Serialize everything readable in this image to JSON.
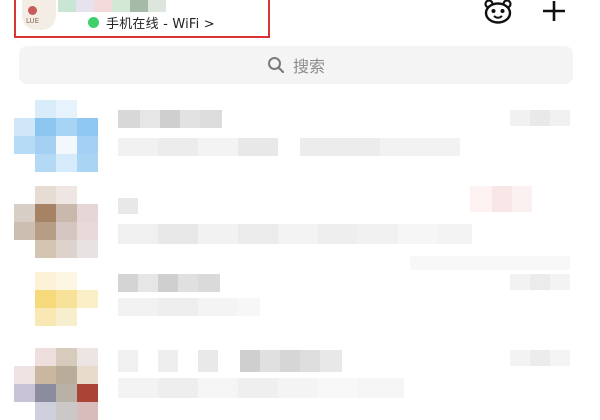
{
  "header": {
    "status_text": "手机在线 - WiFi >",
    "status_color": "#3fcf6b",
    "highlight_color": "#d93333",
    "avatar_caption": "LUE",
    "icons": [
      "mascot-icon",
      "plus-icon"
    ]
  },
  "search": {
    "placeholder": "搜索",
    "icon": "search-icon"
  },
  "conversations": [
    {
      "id": 1,
      "avatar": "blurred-blue-avatar",
      "name": "",
      "preview": "",
      "time": ""
    },
    {
      "id": 2,
      "avatar": "blurred-brown-avatar",
      "name": "",
      "preview": "",
      "time": ""
    },
    {
      "id": 3,
      "avatar": "blurred-yellow-avatar",
      "name": "",
      "preview": "",
      "time": ""
    },
    {
      "id": 4,
      "avatar": "blurred-mixed-avatar",
      "name": "",
      "preview": "",
      "time": ""
    }
  ]
}
